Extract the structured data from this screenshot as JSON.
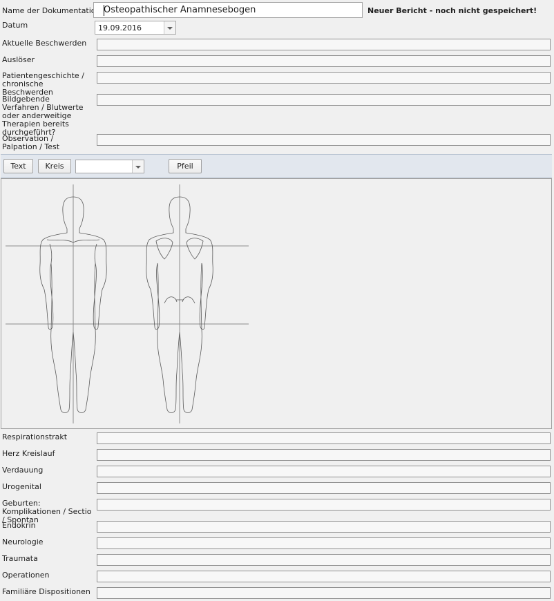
{
  "header": {
    "name_label": "Name der Dokumentation:",
    "name_value": "Osteopathischer Anamnesebogen",
    "status": "Neuer Bericht - noch nicht gespeichert!",
    "date_label": "Datum",
    "date_value": "19.09.2016"
  },
  "top_fields": [
    {
      "label": "Aktuelle Beschwerden"
    },
    {
      "label": "Auslöser"
    },
    {
      "label": "Patientengeschichte / chronische Beschwerden"
    },
    {
      "label": "Bildgebende Verfahren / Blutwerte oder anderweitige Therapien bereits durchgeführt?"
    },
    {
      "label": "Observation / Palpation / Test"
    }
  ],
  "toolbar": {
    "text_button": "Text",
    "circle_button": "Kreis",
    "shape_select_value": "",
    "arrow_button": "Pfeil"
  },
  "bottom_fields": [
    {
      "label": "Respirationstrakt"
    },
    {
      "label": "Herz Kreislauf"
    },
    {
      "label": "Verdauung"
    },
    {
      "label": "Urogenital"
    },
    {
      "label": "Geburten: Komplikationen / Sectio / Spontan"
    },
    {
      "label": "Endokrin"
    },
    {
      "label": "Neurologie"
    },
    {
      "label": "Traumata"
    },
    {
      "label": "Operationen"
    },
    {
      "label": "Familiäre Dispositionen"
    }
  ]
}
